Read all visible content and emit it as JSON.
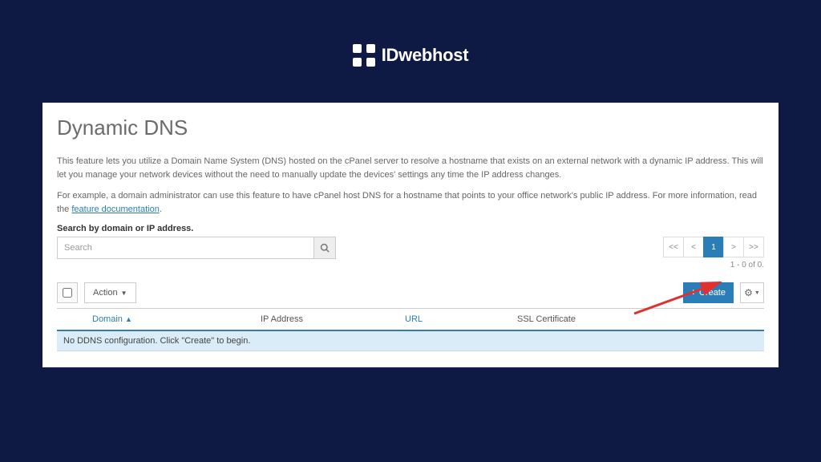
{
  "brand": {
    "name": "IDwebhost"
  },
  "page": {
    "title": "Dynamic DNS",
    "desc1": "This feature lets you utilize a Domain Name System (DNS) hosted on the cPanel server to resolve a hostname that exists on an external network with a dynamic IP address. This will let you manage your network devices without the need to manually update the devices' settings any time the IP address changes.",
    "desc2_pre": "For example, a domain administrator can use this feature to have cPanel host DNS for a hostname that points to your office network's public IP address. For more information, read the ",
    "desc2_link": "feature documentation",
    "desc2_post": "."
  },
  "search": {
    "label": "Search by domain or IP address.",
    "placeholder": "Search"
  },
  "pager": {
    "first": "<<",
    "prev": "<",
    "page": "1",
    "next": ">",
    "last": ">>",
    "count": "1 - 0 of 0."
  },
  "actions": {
    "dropdown": "Action",
    "create": "Create"
  },
  "table": {
    "headers": {
      "domain": "Domain",
      "ip": "IP Address",
      "url": "URL",
      "ssl": "SSL Certificate"
    },
    "empty": "No DDNS configuration. Click \"Create\" to begin."
  }
}
